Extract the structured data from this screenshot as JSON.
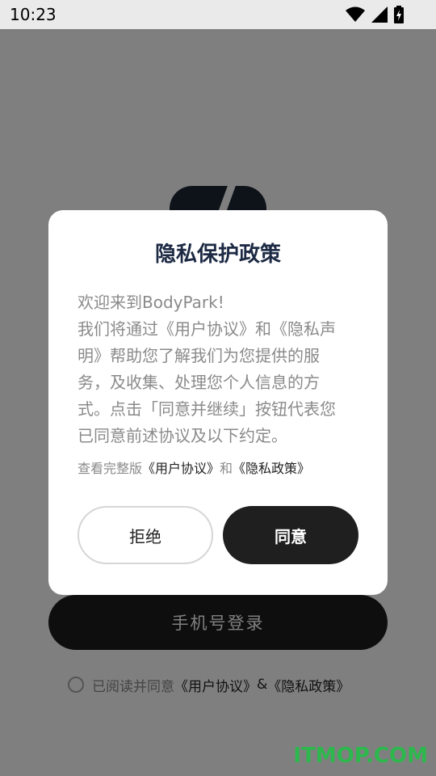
{
  "status_bar": {
    "time": "10:23"
  },
  "login": {
    "phone_login_label": "手机号登录",
    "consent_prefix": "已阅读并同意",
    "user_agreement": "《用户协议》",
    "and_symbol": "&",
    "privacy_policy": "《隐私政策》"
  },
  "dialog": {
    "title": "隐私保护政策",
    "body_lines": [
      "欢迎来到BodyPark!",
      "我们将通过《用户协议》和《隐私声",
      "明》帮助您了解我们为您提供的服",
      "务，及收集、处理您个人信息的方",
      "式。点击「同意并继续」按钮代表您",
      "已同意前述协议及以下约定。"
    ],
    "view_prefix": "查看完整版",
    "view_user_agreement": "《用户协议》",
    "view_and": "和",
    "view_privacy_policy": "《隐私政策》",
    "reject_label": "拒绝",
    "agree_label": "同意"
  },
  "watermark": "ITMOP.COM"
}
